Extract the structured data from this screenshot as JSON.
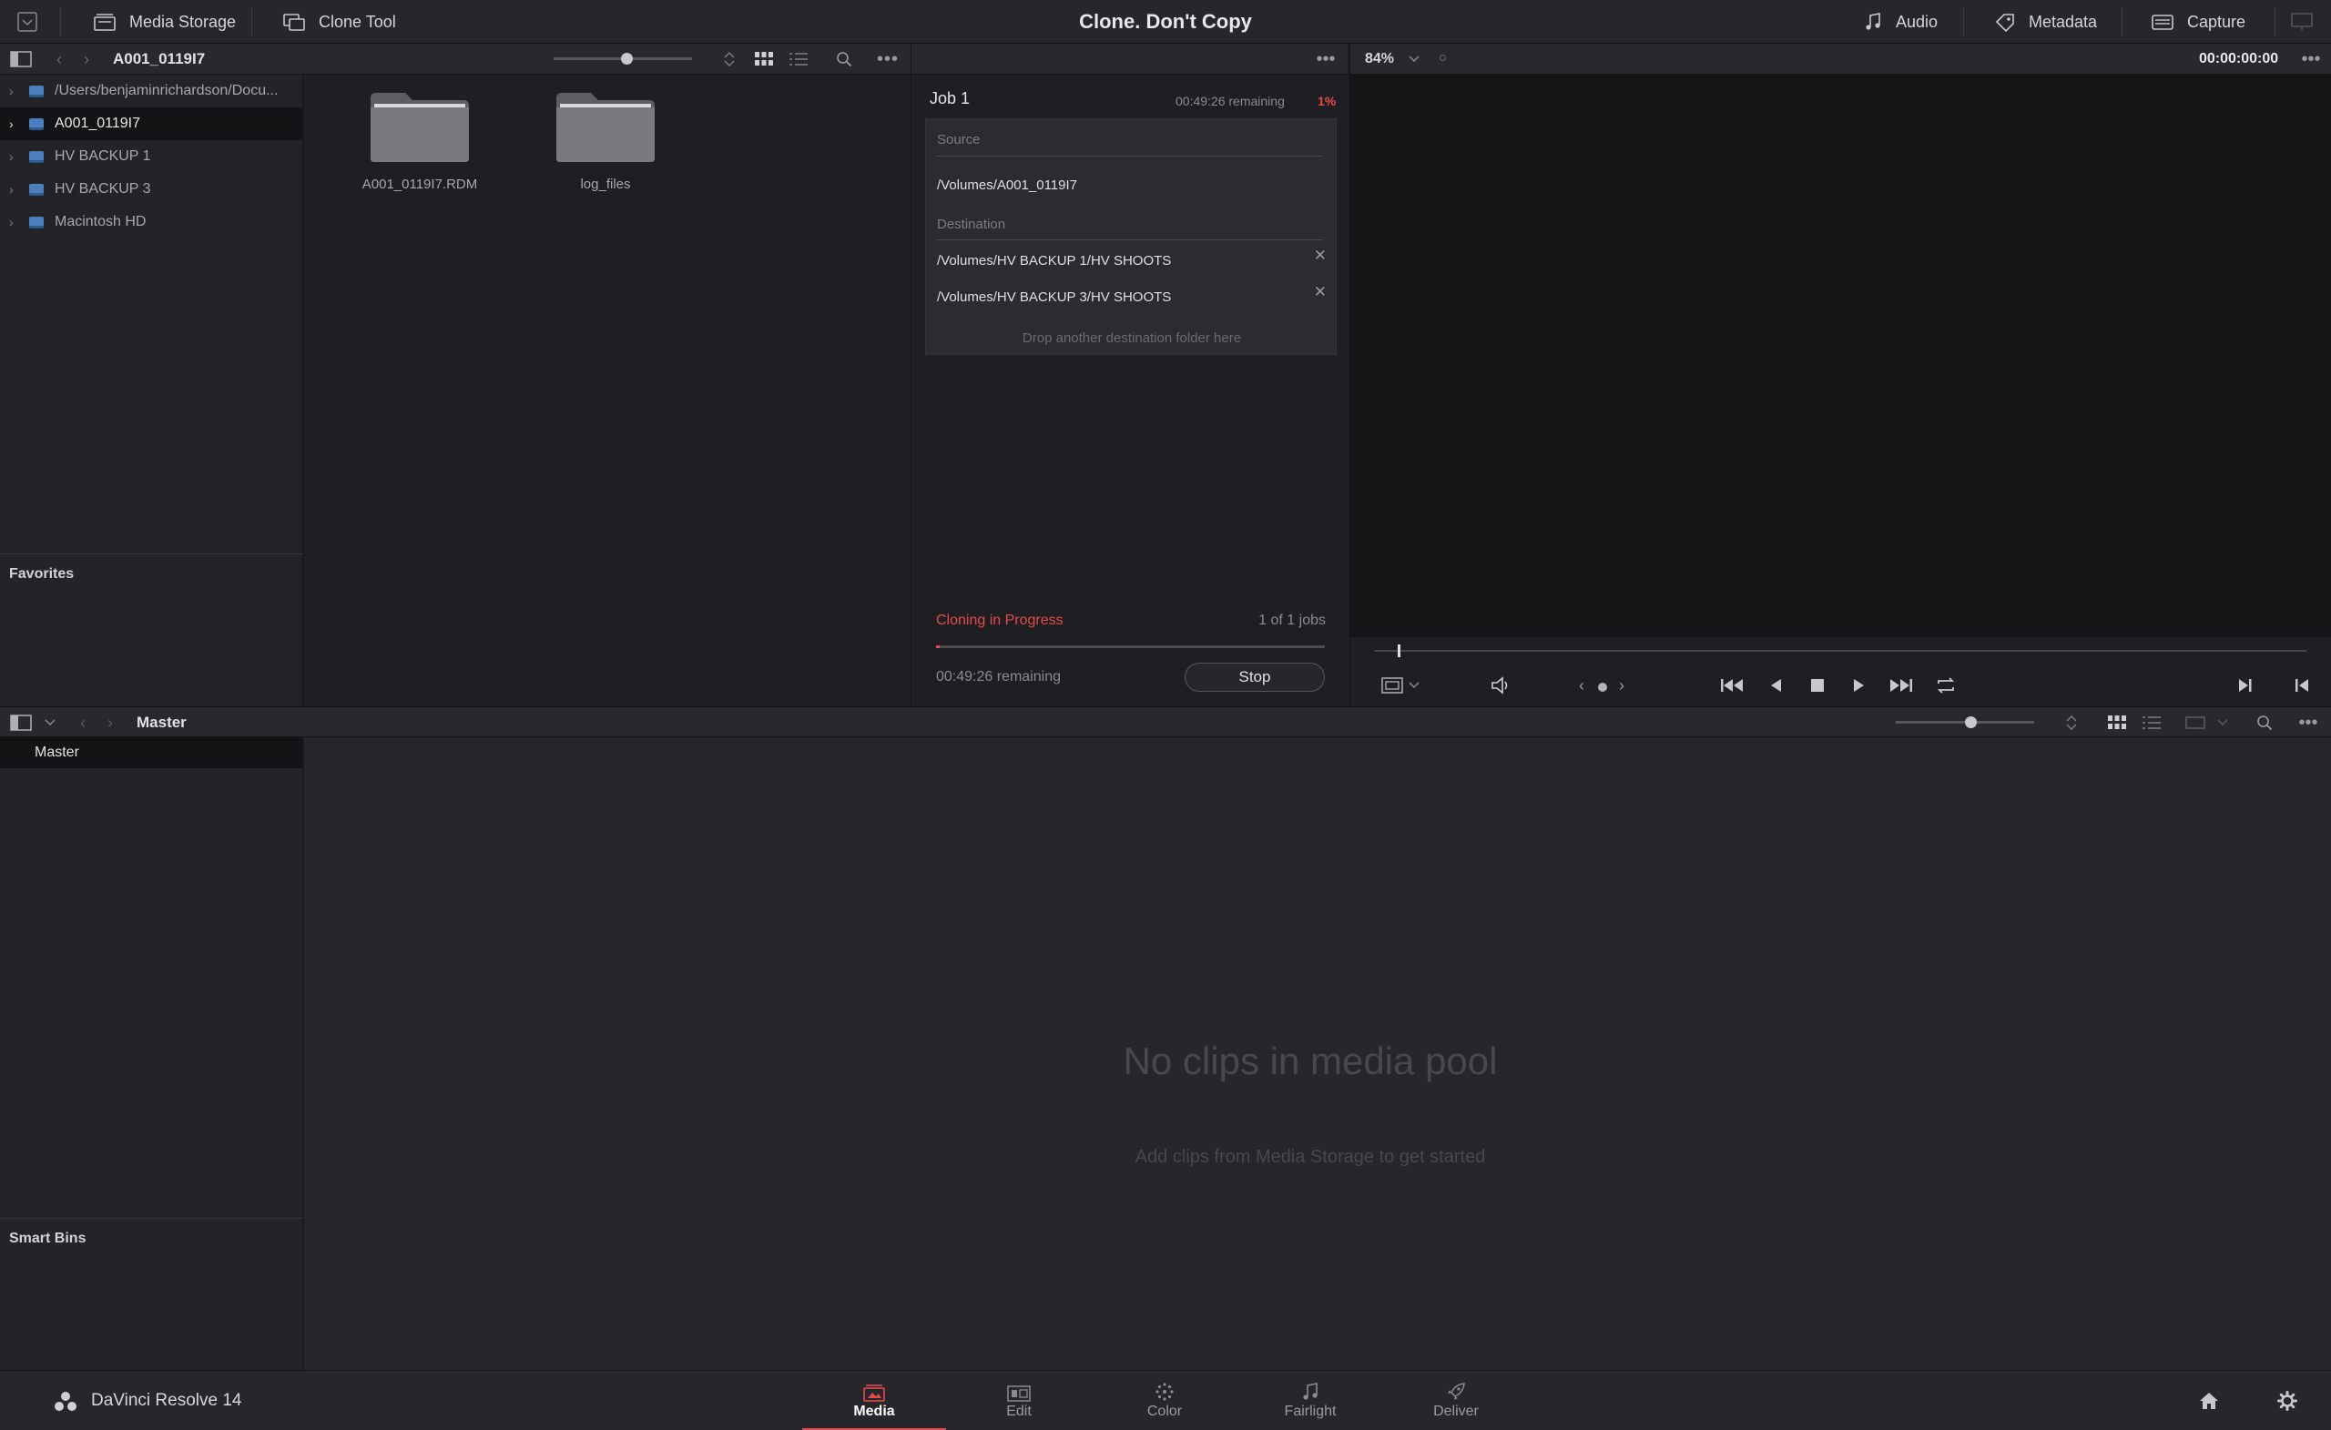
{
  "topbar": {
    "media_storage": "Media Storage",
    "clone_tool": "Clone Tool",
    "title": "Clone. Don't Copy",
    "audio": "Audio",
    "metadata": "Metadata",
    "capture": "Capture"
  },
  "storage": {
    "current_folder": "A001_0119I7",
    "tree": [
      {
        "label": "/Users/benjaminrichardson/Docu...",
        "selected": false
      },
      {
        "label": "A001_0119I7",
        "selected": true
      },
      {
        "label": "HV BACKUP 1",
        "selected": false
      },
      {
        "label": "HV BACKUP 3",
        "selected": false
      },
      {
        "label": "Macintosh HD",
        "selected": false
      }
    ],
    "favorites_label": "Favorites",
    "thumbs": [
      {
        "label": "A001_0119I7.RDM"
      },
      {
        "label": "log_files"
      }
    ]
  },
  "clone": {
    "job_title": "Job 1",
    "job_remaining": "00:49:26 remaining",
    "job_percent": "1%",
    "source_label": "Source",
    "source_path": "/Volumes/A001_0119I7",
    "destination_label": "Destination",
    "destinations": [
      "/Volumes/HV BACKUP 1/HV SHOOTS",
      "/Volumes/HV BACKUP 3/HV SHOOTS"
    ],
    "drop_hint": "Drop another destination folder here",
    "status": "Cloning in Progress",
    "jobs_count": "1 of 1 jobs",
    "progress": 0.01,
    "total_remaining": "00:49:26 remaining",
    "stop_label": "Stop"
  },
  "viewer": {
    "zoom": "84%",
    "timecode": "00:00:00:00"
  },
  "pool": {
    "bin_title": "Master",
    "bins": [
      "Master"
    ],
    "smart_bins_label": "Smart Bins",
    "empty_title": "No clips in media pool",
    "empty_hint": "Add clips from Media Storage to get started"
  },
  "pagebar": {
    "app_name": "DaVinci Resolve 14",
    "pages": [
      {
        "label": "Media",
        "icon": "media-page-icon",
        "active": true
      },
      {
        "label": "Edit",
        "icon": "edit-page-icon",
        "active": false
      },
      {
        "label": "Color",
        "icon": "color-page-icon",
        "active": false
      },
      {
        "label": "Fairlight",
        "icon": "fairlight-page-icon",
        "active": false
      },
      {
        "label": "Deliver",
        "icon": "deliver-page-icon",
        "active": false
      }
    ]
  },
  "colors": {
    "accent_red": "#e64b4b",
    "drive_blue": "#4a7fbf"
  }
}
